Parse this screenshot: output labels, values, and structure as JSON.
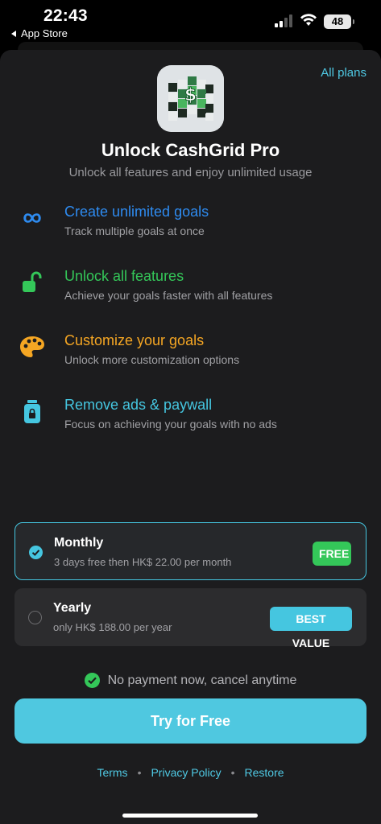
{
  "status": {
    "time": "22:43",
    "back_app": "App Store",
    "battery": "48"
  },
  "header": {
    "all_plans_label": "All plans",
    "title": "Unlock CashGrid Pro",
    "subtitle": "Unlock all features and enjoy unlimited usage"
  },
  "features": [
    {
      "icon": "infinity-icon",
      "title": "Create unlimited goals",
      "desc": "Track multiple goals at once",
      "color": "#2e8bf0"
    },
    {
      "icon": "unlock-icon",
      "title": "Unlock all features",
      "desc": "Achieve your goals faster with all features",
      "color": "#34c759"
    },
    {
      "icon": "palette-icon",
      "title": "Customize your goals",
      "desc": "Unlock more customization options",
      "color": "#f5a623"
    },
    {
      "icon": "jar-icon",
      "title": "Remove ads & paywall",
      "desc": "Focus on achieving your goals with no ads",
      "color": "#45c6e0"
    }
  ],
  "plans": [
    {
      "name": "Monthly",
      "desc": "3 days free then HK$ 22.00 per month",
      "badge": "FREE",
      "selected": true
    },
    {
      "name": "Yearly",
      "desc": "only HK$ 188.00 per year",
      "badge": "BEST VALUE",
      "selected": false
    }
  ],
  "guarantee": "No payment now, cancel anytime",
  "cta_label": "Try for Free",
  "footer": {
    "terms": "Terms",
    "privacy": "Privacy Policy",
    "restore": "Restore",
    "separator": "•"
  },
  "colors": {
    "accent": "#45c6e0",
    "green": "#34c759",
    "blue": "#2e8bf0",
    "orange": "#f5a623",
    "background": "#1c1c1e"
  }
}
